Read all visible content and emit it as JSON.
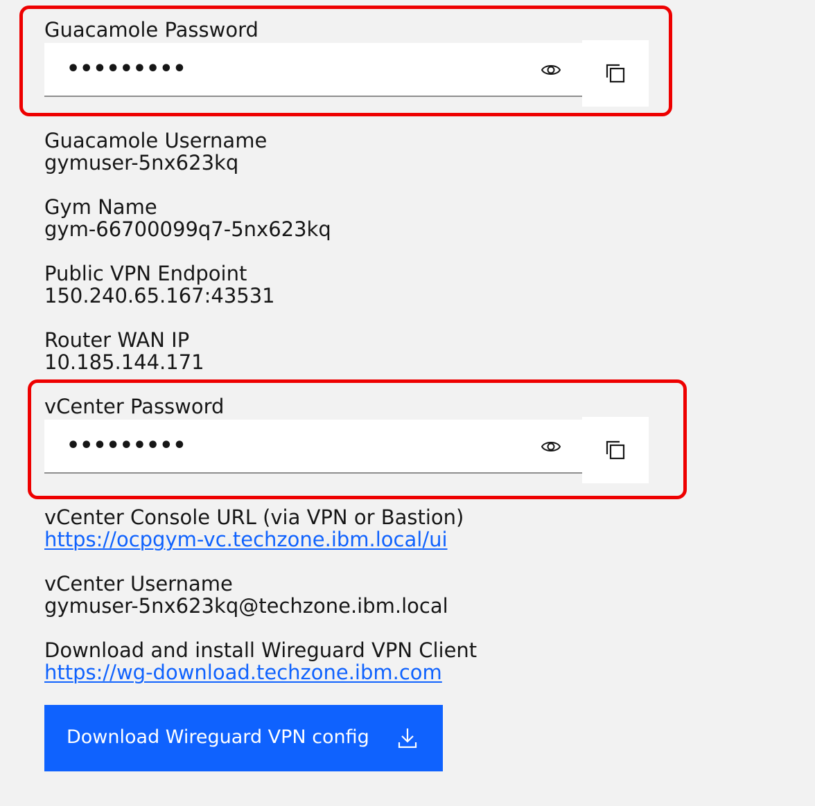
{
  "guacamole_password": {
    "label": "Guacamole Password",
    "masked_value": "•••••••••",
    "show_icon": "eye-icon",
    "copy_icon": "copy-icon"
  },
  "guacamole_username": {
    "label": "Guacamole Username",
    "value": "gymuser-5nx623kq"
  },
  "gym_name": {
    "label": "Gym Name",
    "value": "gym-66700099q7-5nx623kq"
  },
  "public_vpn_endpoint": {
    "label": "Public VPN Endpoint",
    "value": "150.240.65.167:43531"
  },
  "router_wan_ip": {
    "label": "Router WAN IP",
    "value": "10.185.144.171"
  },
  "vcenter_password": {
    "label": "vCenter Password",
    "masked_value": "•••••••••",
    "show_icon": "eye-icon",
    "copy_icon": "copy-icon"
  },
  "vcenter_console_url": {
    "label": "vCenter Console URL (via VPN or Bastion)",
    "link": "https://ocpgym-vc.techzone.ibm.local/ui"
  },
  "vcenter_username": {
    "label": "vCenter Username",
    "value": "gymuser-5nx623kq@techzone.ibm.local"
  },
  "wireguard_client": {
    "label": "Download and install Wireguard VPN Client",
    "link": "https://wg-download.techzone.ibm.com"
  },
  "download_button": {
    "label": "Download Wireguard VPN config",
    "icon": "download-icon"
  },
  "colors": {
    "background": "#f2f2f2",
    "highlight": "#ee0000",
    "link": "#0f62fe",
    "primary_button": "#0f62fe"
  }
}
